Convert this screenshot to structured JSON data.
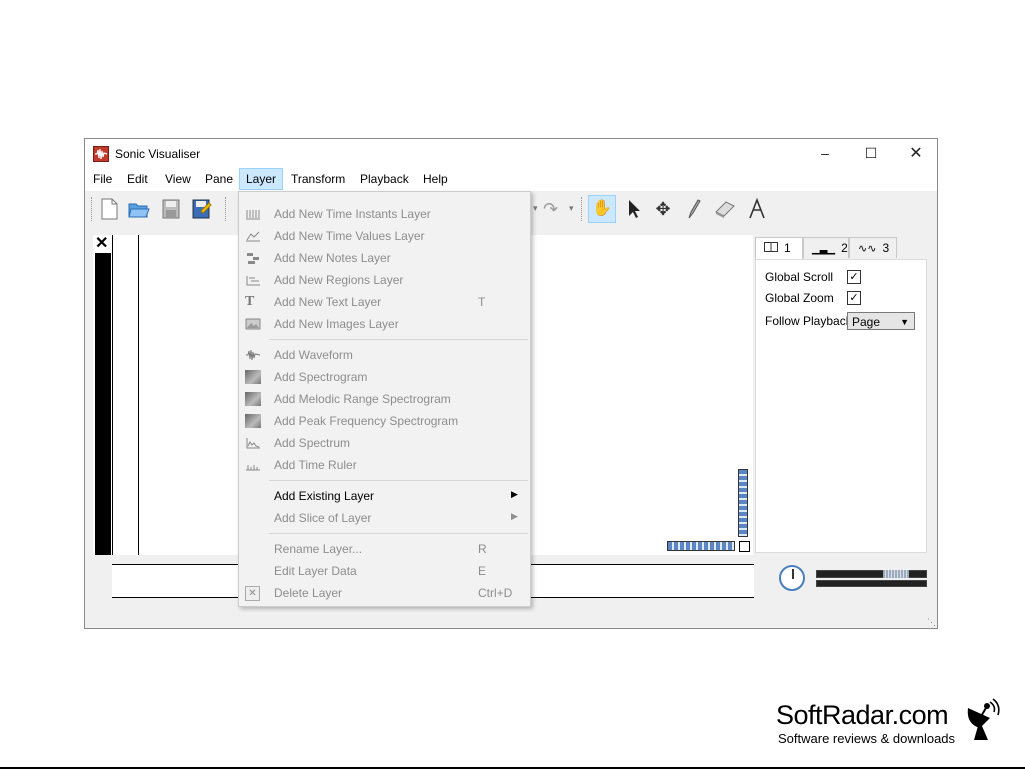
{
  "window": {
    "title": "Sonic Visualiser",
    "icon": "sonic-visualiser-logo-icon",
    "controls": [
      "minimize-icon",
      "maximize-icon",
      "close-icon"
    ]
  },
  "menubar": {
    "items": [
      "File",
      "Edit",
      "View",
      "Pane",
      "Layer",
      "Transform",
      "Playback",
      "Help"
    ],
    "active": "Layer"
  },
  "toolbar": {
    "icons": [
      "new-file-icon",
      "open-folder-icon",
      "save-icon",
      "save-as-icon",
      "undo-dropdown-icon",
      "redo-icon",
      "navigate-hand-icon",
      "select-arrow-icon",
      "move-icon",
      "draw-pencil-icon",
      "erase-icon",
      "measure-icon"
    ]
  },
  "pane": {
    "close_glyph": "✕"
  },
  "tabs": [
    {
      "label": "1",
      "icon": "pane-layout-icon"
    },
    {
      "label": "2",
      "icon": "time-ruler-icon"
    },
    {
      "label": "3",
      "icon": "waveform-icon"
    }
  ],
  "props": {
    "global_scroll": "Global Scroll",
    "global_zoom": "Global Zoom",
    "follow_playback": "Follow Playback",
    "follow_value": "Page",
    "global_scroll_checked": true,
    "global_zoom_checked": true
  },
  "layer_menu": {
    "items": [
      {
        "label": "Add New Time Instants Layer",
        "shortcut": "",
        "icon": "time-instants-icon",
        "enabled": false
      },
      {
        "label": "Add New Time Values Layer",
        "shortcut": "",
        "icon": "time-values-icon",
        "enabled": false
      },
      {
        "label": "Add New Notes Layer",
        "shortcut": "",
        "icon": "notes-icon",
        "enabled": false
      },
      {
        "label": "Add New Regions Layer",
        "shortcut": "",
        "icon": "regions-icon",
        "enabled": false
      },
      {
        "label": "Add New Text Layer",
        "shortcut": "T",
        "icon": "text-icon",
        "enabled": false
      },
      {
        "label": "Add New Images Layer",
        "shortcut": "",
        "icon": "images-icon",
        "enabled": false
      },
      {
        "label": "Add Waveform",
        "shortcut": "",
        "icon": "waveform-icon",
        "enabled": false
      },
      {
        "label": "Add Spectrogram",
        "shortcut": "",
        "icon": "spectrogram-icon",
        "enabled": false
      },
      {
        "label": "Add Melodic Range Spectrogram",
        "shortcut": "",
        "icon": "spectrogram-icon",
        "enabled": false
      },
      {
        "label": "Add Peak Frequency Spectrogram",
        "shortcut": "",
        "icon": "spectrogram-icon",
        "enabled": false
      },
      {
        "label": "Add Spectrum",
        "shortcut": "",
        "icon": "spectrum-icon",
        "enabled": false
      },
      {
        "label": "Add Time Ruler",
        "shortcut": "",
        "icon": "time-ruler-icon",
        "enabled": false
      },
      {
        "label": "Add Existing Layer",
        "shortcut": "",
        "icon": "",
        "enabled": true
      },
      {
        "label": "Add Slice of Layer",
        "shortcut": "",
        "icon": "",
        "enabled": false
      },
      {
        "label": "Rename Layer...",
        "shortcut": "R",
        "icon": "",
        "enabled": false
      },
      {
        "label": "Edit Layer Data",
        "shortcut": "E",
        "icon": "",
        "enabled": false
      },
      {
        "label": "Delete Layer",
        "shortcut": "Ctrl+D",
        "icon": "delete-icon",
        "enabled": false
      }
    ]
  },
  "branding": {
    "name": "SoftRadar.com",
    "tagline": "Software reviews & downloads",
    "icon": "satellite-dish-icon"
  }
}
